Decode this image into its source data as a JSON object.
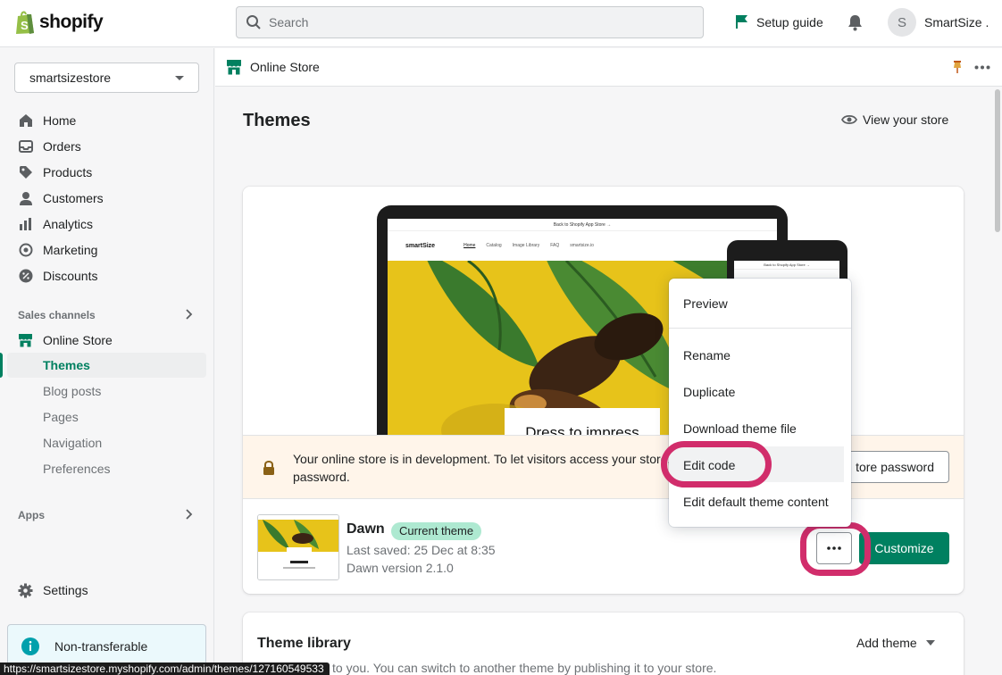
{
  "topbar": {
    "logo_text": "shopify",
    "search_placeholder": "Search",
    "setup_guide": "Setup guide",
    "user_initial": "S",
    "user_name": "SmartSize ."
  },
  "sidebar": {
    "store_name": "smartsizestore",
    "items": [
      {
        "label": "Home",
        "icon": "home-icon"
      },
      {
        "label": "Orders",
        "icon": "inbox-icon"
      },
      {
        "label": "Products",
        "icon": "tag-icon"
      },
      {
        "label": "Customers",
        "icon": "person-icon"
      },
      {
        "label": "Analytics",
        "icon": "bar-chart-icon"
      },
      {
        "label": "Marketing",
        "icon": "target-icon"
      },
      {
        "label": "Discounts",
        "icon": "discount-icon"
      }
    ],
    "sales_channels_label": "Sales channels",
    "online_store_label": "Online Store",
    "sub_items": [
      "Themes",
      "Blog posts",
      "Pages",
      "Navigation",
      "Preferences"
    ],
    "apps_label": "Apps",
    "settings_label": "Settings",
    "nontransferable_label": "Non-transferable"
  },
  "subheader": {
    "title": "Online Store"
  },
  "page": {
    "title": "Themes",
    "view_store": "View your store"
  },
  "preview": {
    "laptop_banner": "Back to Shopify App Store →",
    "brand": "smartSize",
    "nav_links": [
      "Home",
      "Catalog",
      "Image Library",
      "FAQ",
      "smartsize.io"
    ],
    "phone_banner": "Back to Shopify App Store →",
    "hero_text": "Dress to impress"
  },
  "dev_banner": {
    "text": "Your online store is in development. To let visitors access your store, give them the password.",
    "button": "tore password"
  },
  "theme": {
    "name": "Dawn",
    "badge": "Current theme",
    "last_saved": "Last saved: 25 Dec at 8:35",
    "version": "Dawn version 2.1.0",
    "customize": "Customize"
  },
  "dropdown": {
    "items": [
      "Preview",
      "Rename",
      "Duplicate",
      "Download theme file",
      "Edit code",
      "Edit default theme content"
    ]
  },
  "library": {
    "title": "Theme library",
    "add_theme": "Add theme",
    "subtitle": "e only visible to you. You can switch to another theme by publishing it to your store."
  },
  "statusbar": {
    "url": "https://smartsizestore.myshopify.com/admin/themes/127160549533"
  },
  "colors": {
    "accent": "#008060",
    "highlight_ring": "#d12d6b",
    "badge": "#aee9d1",
    "dev_banner_bg": "#fff5ea"
  }
}
